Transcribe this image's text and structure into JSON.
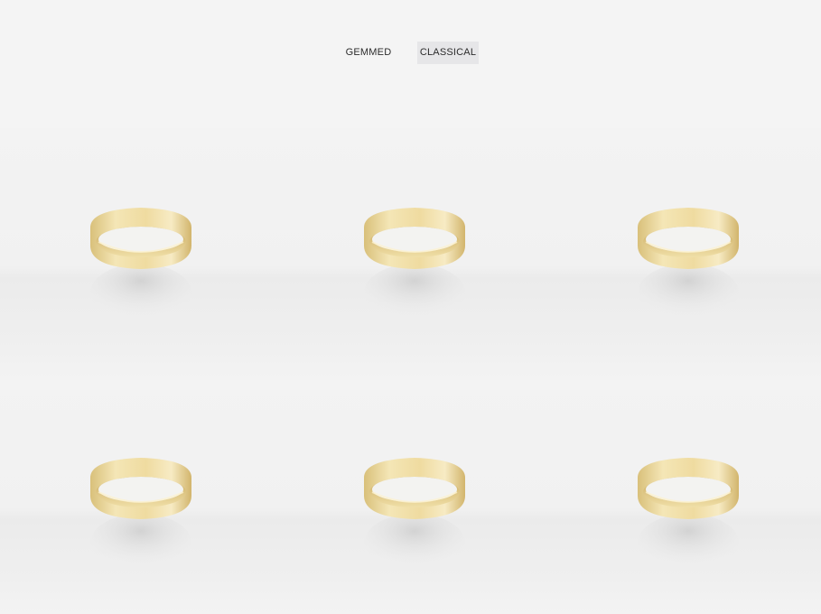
{
  "filters": {
    "gemmed_label": "GEMMED",
    "classical_label": "CLASSICAL",
    "selected": "CLASSICAL"
  },
  "products": {
    "count": 6,
    "item_name": "gold-band-ring",
    "ring_color": "#e8d49a"
  }
}
